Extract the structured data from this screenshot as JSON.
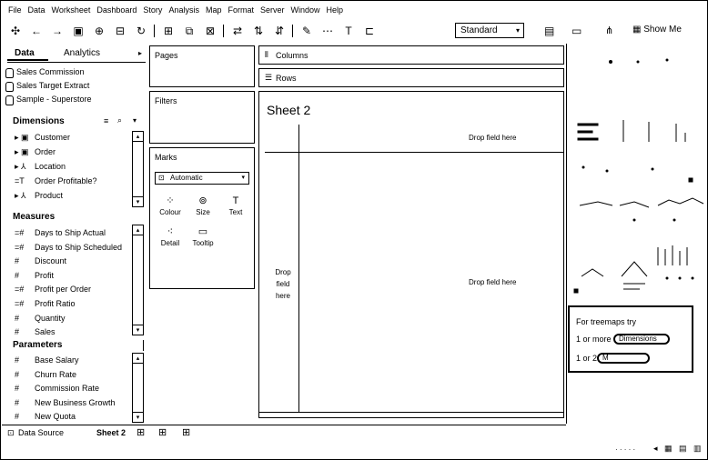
{
  "menu": [
    "File",
    "Data",
    "Worksheet",
    "Dashboard",
    "Story",
    "Analysis",
    "Map",
    "Format",
    "Server",
    "Window",
    "Help"
  ],
  "toolbar": {
    "fit_select": "Standard",
    "show_me_label": "Show Me"
  },
  "data_pane": {
    "tab_data": "Data",
    "tab_analytics": "Analytics",
    "data_sources": [
      "Sales Commission",
      "Sales Target Extract",
      "Sample - Superstore"
    ],
    "dimensions_header": "Dimensions",
    "dimensions": [
      {
        "icon": "folder-icon",
        "glyph": "▸ ▣",
        "label": "Customer"
      },
      {
        "icon": "folder-icon",
        "glyph": "▸ ▣",
        "label": "Order"
      },
      {
        "icon": "hierarchy-icon",
        "glyph": "▸ ⅄",
        "label": "Location"
      },
      {
        "icon": "calc-field-icon",
        "glyph": "=T",
        "label": "Order Profitable?"
      },
      {
        "icon": "hierarchy-icon",
        "glyph": "▸ ⅄",
        "label": "Product"
      }
    ],
    "measures_header": "Measures",
    "measures": [
      {
        "glyph": "=#",
        "label": "Days to Ship Actual"
      },
      {
        "glyph": "=#",
        "label": "Days to Ship Scheduled"
      },
      {
        "glyph": "#",
        "label": "Discount"
      },
      {
        "glyph": "#",
        "label": "Profit"
      },
      {
        "glyph": "=#",
        "label": "Profit per Order"
      },
      {
        "glyph": "=#",
        "label": "Profit Ratio"
      },
      {
        "glyph": "#",
        "label": "Quantity"
      },
      {
        "glyph": "#",
        "label": "Sales"
      }
    ],
    "parameters_header": "Parameters",
    "parameters": [
      {
        "glyph": "#",
        "label": "Base Salary"
      },
      {
        "glyph": "#",
        "label": "Churn Rate"
      },
      {
        "glyph": "#",
        "label": "Commission Rate"
      },
      {
        "glyph": "#",
        "label": "New Business Growth"
      },
      {
        "glyph": "#",
        "label": "New Quota"
      }
    ]
  },
  "cards": {
    "pages": "Pages",
    "filters": "Filters",
    "marks": "Marks",
    "marks_type": "Automatic",
    "mark_buttons": [
      "Colour",
      "Size",
      "Text",
      "Detail",
      "Tooltip"
    ]
  },
  "shelves": {
    "columns": "Columns",
    "rows": "Rows"
  },
  "sheet": {
    "title": "Sheet 2",
    "drop_top": "Drop field here",
    "drop_mid": "Drop field here",
    "drop_left": "Drop field here"
  },
  "show_me": {
    "hint_title": "For treemaps try",
    "row1_prefix": "1 or more",
    "row1_pill": "Dimensions",
    "row2_prefix": "1 or 2",
    "row2_pill": "M"
  },
  "bottom": {
    "data_source": "Data Source",
    "sheet_tab": "Sheet 2"
  }
}
